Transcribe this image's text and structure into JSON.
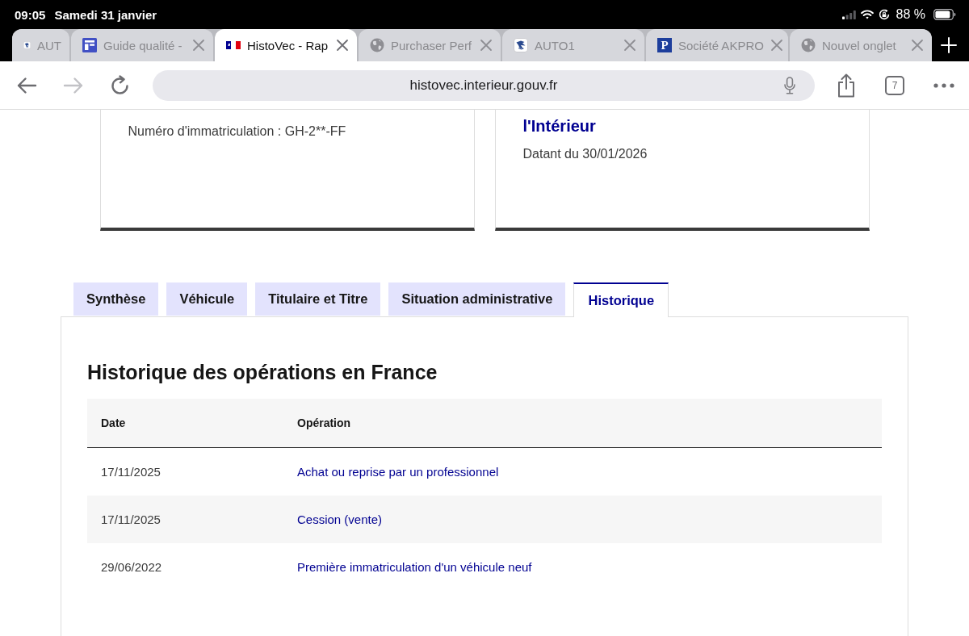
{
  "status_bar": {
    "time": "09:05",
    "date": "Samedi 31 janvier",
    "battery": "88 %"
  },
  "browser_tabs": [
    {
      "title": "AUT",
      "kind": "bird",
      "selected": false,
      "covered": true
    },
    {
      "title": "Guide qualité -",
      "kind": "layout",
      "selected": false,
      "covered": false
    },
    {
      "title": "HistoVec - Rap",
      "kind": "flag",
      "selected": true,
      "covered": false
    },
    {
      "title": "Purchaser Perf",
      "kind": "globe",
      "selected": false,
      "covered": false
    },
    {
      "title": "AUTO1",
      "kind": "bird",
      "selected": false,
      "covered": false
    },
    {
      "title": "Société AKPRO",
      "kind": "letter",
      "letter": "P",
      "selected": false,
      "covered": false
    },
    {
      "title": "Nouvel onglet",
      "kind": "globe",
      "selected": false,
      "covered": false
    }
  ],
  "toolbar": {
    "buttons": [
      {
        "kind": "back",
        "disabled": false
      },
      {
        "kind": "forward",
        "disabled": true
      },
      {
        "kind": "reload",
        "disabled": false
      }
    ],
    "address": "histovec.interieur.gouv.fr",
    "tab_count": "7"
  },
  "cards": [
    {
      "lines": [
        {
          "kind": "text",
          "text": "Numéro d'immatriculation : GH-2**-FF"
        }
      ]
    },
    {
      "lines": [
        {
          "kind": "title",
          "text": "l'Intérieur"
        },
        {
          "kind": "text",
          "text": "Datant du 30/01/2026"
        }
      ]
    }
  ],
  "report_tabs": [
    {
      "label": "Synthèse",
      "selected": false
    },
    {
      "label": "Véhicule",
      "selected": false
    },
    {
      "label": "Titulaire et Titre",
      "selected": false
    },
    {
      "label": "Situation administrative",
      "selected": false
    },
    {
      "label": "Historique",
      "selected": true
    }
  ],
  "history": {
    "title": "Historique des opérations en France",
    "columns": [
      "Date",
      "Opération"
    ],
    "rows": [
      {
        "date": "17/11/2025",
        "operation": "Achat ou reprise par un professionnel"
      },
      {
        "date": "17/11/2025",
        "operation": "Cession (vente)"
      },
      {
        "date": "29/06/2022",
        "operation": "Première immatriculation d'un véhicule neuf"
      }
    ]
  }
}
